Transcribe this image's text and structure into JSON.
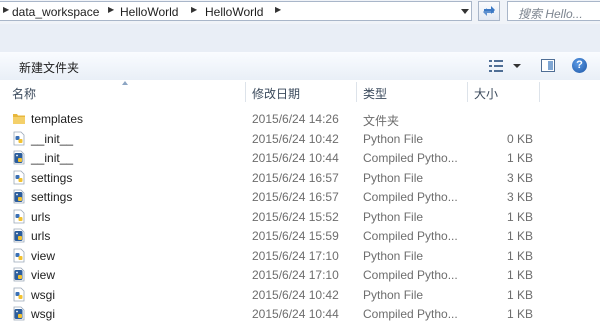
{
  "address_bar": {
    "crumbs": [
      "data_workspace",
      "HelloWorld",
      "HelloWorld"
    ],
    "search_placeholder": "搜索 Hello..."
  },
  "toolbar": {
    "new_folder_label": "新建文件夹"
  },
  "columns": {
    "name": "名称",
    "date": "修改日期",
    "type": "类型",
    "size": "大小"
  },
  "files": [
    {
      "name": "templates",
      "date": "2015/6/24 14:26",
      "type": "文件夹",
      "size": "",
      "icon": "folder-icon"
    },
    {
      "name": "__init__",
      "date": "2015/6/24 10:42",
      "type": "Python File",
      "size": "0 KB",
      "icon": "python-file-icon"
    },
    {
      "name": "__init__",
      "date": "2015/6/24 10:44",
      "type": "Compiled Pytho...",
      "size": "1 KB",
      "icon": "compiled-python-icon"
    },
    {
      "name": "settings",
      "date": "2015/6/24 16:57",
      "type": "Python File",
      "size": "3 KB",
      "icon": "python-file-icon"
    },
    {
      "name": "settings",
      "date": "2015/6/24 16:57",
      "type": "Compiled Pytho...",
      "size": "3 KB",
      "icon": "compiled-python-icon"
    },
    {
      "name": "urls",
      "date": "2015/6/24 15:52",
      "type": "Python File",
      "size": "1 KB",
      "icon": "python-file-icon"
    },
    {
      "name": "urls",
      "date": "2015/6/24 15:59",
      "type": "Compiled Pytho...",
      "size": "1 KB",
      "icon": "compiled-python-icon"
    },
    {
      "name": "view",
      "date": "2015/6/24 17:10",
      "type": "Python File",
      "size": "1 KB",
      "icon": "python-file-icon"
    },
    {
      "name": "view",
      "date": "2015/6/24 17:10",
      "type": "Compiled Pytho...",
      "size": "1 KB",
      "icon": "compiled-python-icon"
    },
    {
      "name": "wsgi",
      "date": "2015/6/24 10:42",
      "type": "Python File",
      "size": "1 KB",
      "icon": "python-file-icon"
    },
    {
      "name": "wsgi",
      "date": "2015/6/24 10:44",
      "type": "Compiled Pytho...",
      "size": "1 KB",
      "icon": "compiled-python-icon"
    }
  ],
  "colors": {
    "folder": "#e8b73c",
    "python_blue": "#3a70b5",
    "python_yellow": "#f2c230"
  }
}
